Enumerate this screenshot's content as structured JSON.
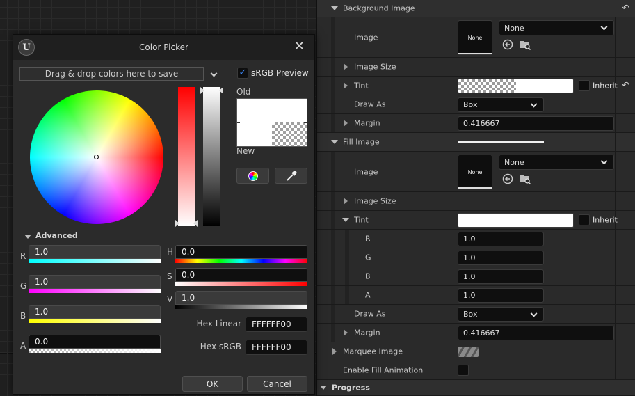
{
  "details": {
    "rows": {
      "bg_image_section": "Background Image",
      "bg_image": "Image",
      "bg_image_thumb": "None",
      "bg_image_dropdown": "None",
      "bg_image_size": "Image Size",
      "bg_tint": "Tint",
      "bg_tint_inherit": "Inherit",
      "bg_draw_as": "Draw As",
      "bg_draw_as_value": "Box",
      "bg_margin": "Margin",
      "bg_margin_value": "0.416667",
      "fill_image_section": "Fill Image",
      "fill_image": "Image",
      "fill_image_thumb": "None",
      "fill_image_dropdown": "None",
      "fill_image_size": "Image Size",
      "fill_tint": "Tint",
      "fill_tint_inherit": "Inherit",
      "r_label": "R",
      "r_value": "1.0",
      "g_label": "G",
      "g_value": "1.0",
      "b_label": "B",
      "b_value": "1.0",
      "a_label": "A",
      "a_value": "1.0",
      "fill_draw_as": "Draw As",
      "fill_draw_as_value": "Box",
      "fill_margin": "Margin",
      "fill_margin_value": "0.416667",
      "marquee_image": "Marquee Image",
      "enable_fill_animation": "Enable Fill Animation",
      "progress_section": "Progress"
    }
  },
  "picker": {
    "title": "Color Picker",
    "logo": "U",
    "dropzone": "Drag & drop colors here to save",
    "srgb_preview": "sRGB Preview",
    "old_label": "Old",
    "new_label": "New",
    "advanced": "Advanced",
    "r_label": "R",
    "r_value": "1.0",
    "g_label": "G",
    "g_value": "1.0",
    "b_label": "B",
    "b_value": "1.0",
    "a_label": "A",
    "a_value": "0.0",
    "h_label": "H",
    "h_value": "0.0",
    "s_label": "S",
    "s_value": "0.0",
    "v_label": "V",
    "v_value": "1.0",
    "hex_linear_label": "Hex Linear",
    "hex_linear_value": "FFFFFF00",
    "hex_srgb_label": "Hex sRGB",
    "hex_srgb_value": "FFFFFF00",
    "ok": "OK",
    "cancel": "Cancel"
  },
  "icons": [
    "ue-logo-icon",
    "close-icon",
    "chevron-down-icon",
    "checkmark-icon",
    "color-wheel-icon",
    "eyedropper-icon",
    "browse-arrow-icon",
    "find-in-browser-icon",
    "reset-to-default-icon"
  ]
}
